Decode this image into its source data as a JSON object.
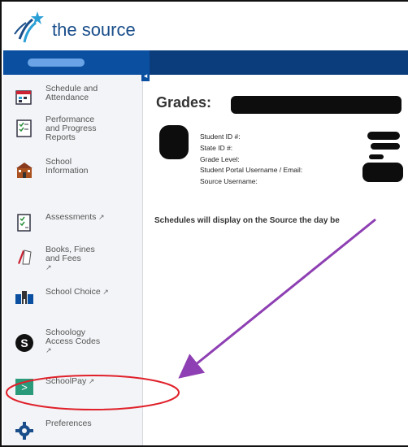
{
  "header": {
    "logo_text": "the source",
    "logo_icon": "source-star-logo"
  },
  "sidebar": {
    "items": [
      {
        "label_lines": [
          "Schedule and",
          "Attendance"
        ],
        "icon": "calendar-icon",
        "external": false
      },
      {
        "label_lines": [
          "Performance",
          "and Progress",
          "Reports"
        ],
        "icon": "report-icon",
        "external": false
      },
      {
        "label_lines": [
          "School",
          "Information"
        ],
        "icon": "school-building-icon",
        "external": false
      },
      {
        "label_lines": [
          "Assessments"
        ],
        "icon": "checklist-icon",
        "external": true
      },
      {
        "label_lines": [
          "Books, Fines",
          "and Fees"
        ],
        "icon": "books-icon",
        "external": true
      },
      {
        "label_lines": [
          "School Choice"
        ],
        "icon": "school-choice-icon",
        "external": true
      },
      {
        "label_lines": [
          "Schoology",
          "Access Codes"
        ],
        "icon": "schoology-icon",
        "external": true
      },
      {
        "label_lines": [
          "SchoolPay"
        ],
        "icon": "schoolpay-icon",
        "external": true
      },
      {
        "label_lines": [
          "Preferences"
        ],
        "icon": "gear-icon",
        "external": false
      }
    ],
    "external_glyph": "↗"
  },
  "main": {
    "title": "Grades:",
    "student_fields": [
      "Student ID #:",
      "State ID #:",
      "Grade Level:",
      "Student Portal Username / Email:",
      "Source Username:"
    ],
    "schedule_message": "Schedules will display on the Source the day be"
  },
  "annotations": {
    "arrow_color": "#8e3fb3",
    "highlight_color": "#e0202a"
  }
}
